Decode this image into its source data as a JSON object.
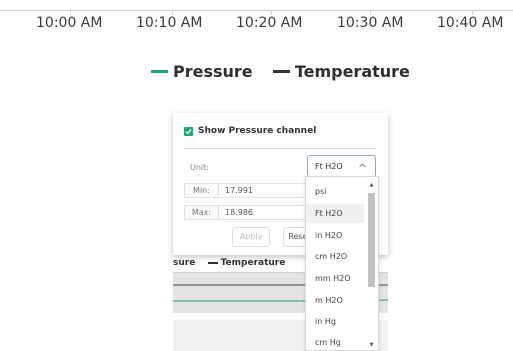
{
  "background_chart": {
    "x_ticks": [
      "10:00 AM",
      "10:10 AM",
      "10:20 AM",
      "10:30 AM",
      "10:40 AM"
    ],
    "legend": [
      {
        "label": "Pressure",
        "color": "#1aa877"
      },
      {
        "label": "Temperature",
        "color": "#333333"
      }
    ]
  },
  "mini_chart": {
    "legend": [
      {
        "label": "sure",
        "color": "#1aa877"
      },
      {
        "label": "Temperature",
        "color": "#333333"
      }
    ]
  },
  "popup": {
    "show_channel": {
      "label": "Show Pressure channel",
      "checked": true
    },
    "unit": {
      "label": "Unit:",
      "value": "Ft H2O"
    },
    "min": {
      "label": "Min:",
      "value": "17.991"
    },
    "max": {
      "label": "Max:",
      "value": "18.986"
    },
    "apply_label": "Apply",
    "reset_label": "Rese"
  },
  "unit_dropdown": {
    "options": [
      "psi",
      "Ft H2O",
      "in H2O",
      "cm H2O",
      "mm H2O",
      "m H2O",
      "in Hg",
      "cm Hg"
    ],
    "selected": "Ft H2O"
  },
  "colors": {
    "accent_green": "#1aa877",
    "select_border": "#8aa6d2"
  }
}
